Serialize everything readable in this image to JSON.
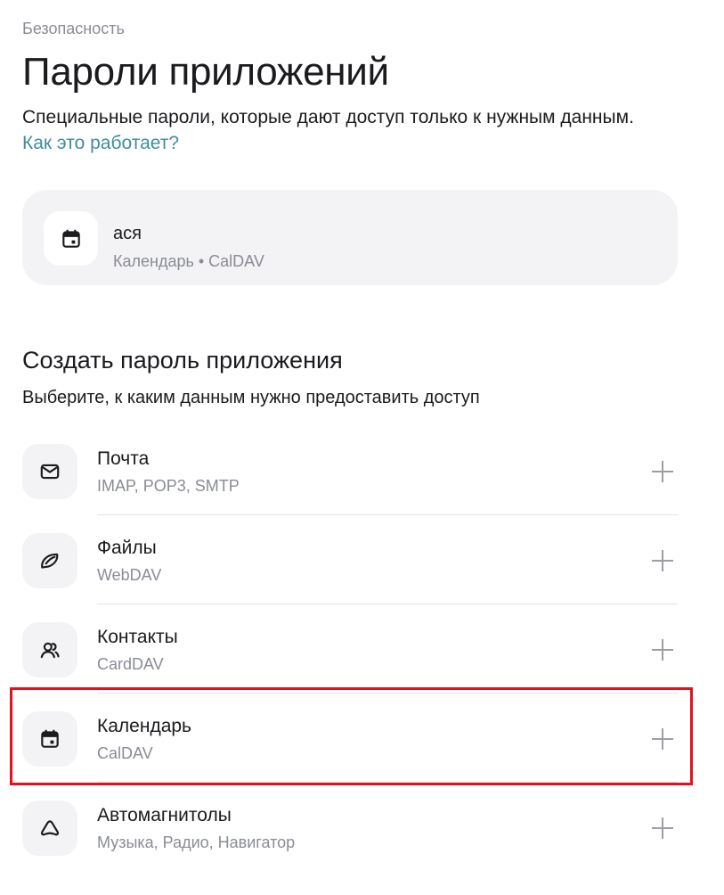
{
  "breadcrumb": "Безопасность",
  "page": {
    "title": "Пароли приложений",
    "description": "Специальные пароли, которые дают доступ только к нужным данным.",
    "help_link": "Как это работает?"
  },
  "existing_password": {
    "name": "ася",
    "detail": "Календарь • CalDAV",
    "icon": "calendar-icon"
  },
  "create": {
    "title": "Создать пароль приложения",
    "description": "Выберите, к каким данным нужно предоставить доступ"
  },
  "apps": [
    {
      "title": "Почта",
      "subtitle": "IMAP, POP3, SMTP",
      "icon": "mail-icon"
    },
    {
      "title": "Файлы",
      "subtitle": "WebDAV",
      "icon": "files-icon"
    },
    {
      "title": "Контакты",
      "subtitle": "CardDAV",
      "icon": "contacts-icon"
    },
    {
      "title": "Календарь",
      "subtitle": "CalDAV",
      "icon": "calendar-icon",
      "highlighted": true
    },
    {
      "title": "Автомагнитолы",
      "subtitle": "Музыка, Радио, Навигатор",
      "icon": "car-audio-icon"
    }
  ],
  "colors": {
    "link": "#3f8f97",
    "muted_text": "#8a8c96",
    "card_bg": "#f3f3f5",
    "highlight_border": "#e3101e"
  }
}
